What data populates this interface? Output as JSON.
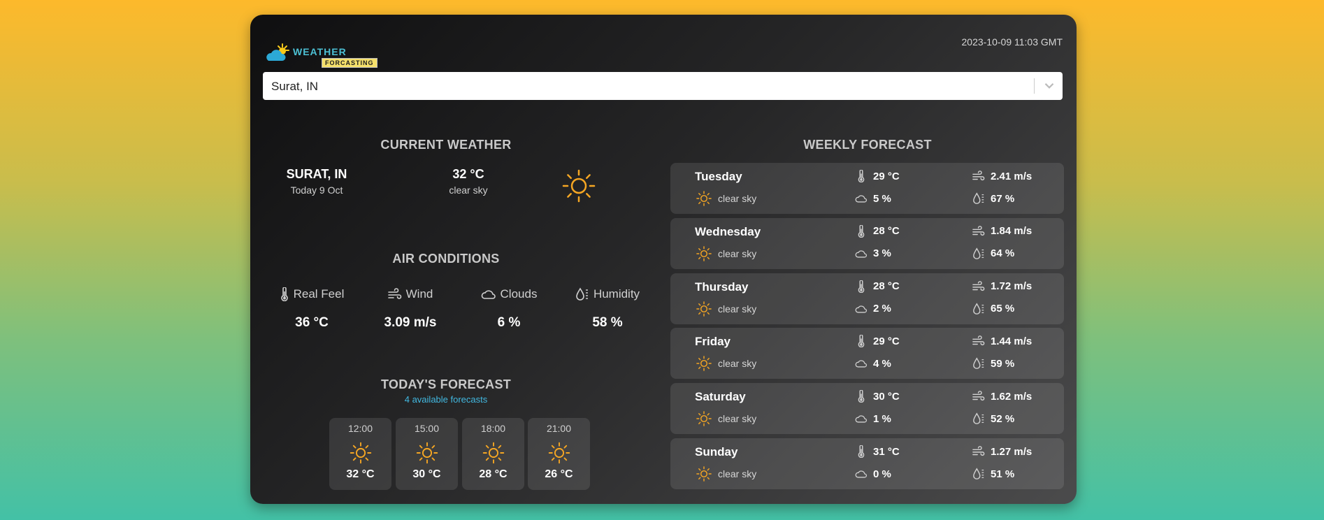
{
  "header": {
    "logo": {
      "word": "WEATHER",
      "sub": "FORCASTING"
    },
    "datetime": "2023-10-09 11:03 GMT"
  },
  "search": {
    "value": "Surat, IN"
  },
  "current": {
    "heading": "CURRENT WEATHER",
    "city": "SURAT, IN",
    "date": "Today 9 Oct",
    "temp": "32 °C",
    "description": "clear sky",
    "icon": "sun-icon"
  },
  "air_conditions": {
    "heading": "AIR CONDITIONS",
    "items": [
      {
        "label": "Real Feel",
        "value": "36 °C",
        "icon": "thermometer-icon"
      },
      {
        "label": "Wind",
        "value": "3.09 m/s",
        "icon": "wind-icon"
      },
      {
        "label": "Clouds",
        "value": "6 %",
        "icon": "cloud-icon"
      },
      {
        "label": "Humidity",
        "value": "58 %",
        "icon": "humidity-icon"
      }
    ]
  },
  "today_forecast": {
    "heading": "TODAY'S FORECAST",
    "subtitle": "4 available forecasts",
    "items": [
      {
        "time": "12:00",
        "temp": "32 °C"
      },
      {
        "time": "15:00",
        "temp": "30 °C"
      },
      {
        "time": "18:00",
        "temp": "28 °C"
      },
      {
        "time": "21:00",
        "temp": "26 °C"
      }
    ]
  },
  "weekly_forecast": {
    "heading": "WEEKLY FORECAST",
    "days": [
      {
        "day": "Tuesday",
        "desc": "clear sky",
        "temp": "29 °C",
        "clouds": "5 %",
        "wind": "2.41 m/s",
        "humidity": "67 %"
      },
      {
        "day": "Wednesday",
        "desc": "clear sky",
        "temp": "28 °C",
        "clouds": "3 %",
        "wind": "1.84 m/s",
        "humidity": "64 %"
      },
      {
        "day": "Thursday",
        "desc": "clear sky",
        "temp": "28 °C",
        "clouds": "2 %",
        "wind": "1.72 m/s",
        "humidity": "65 %"
      },
      {
        "day": "Friday",
        "desc": "clear sky",
        "temp": "29 °C",
        "clouds": "4 %",
        "wind": "1.44 m/s",
        "humidity": "59 %"
      },
      {
        "day": "Saturday",
        "desc": "clear sky",
        "temp": "30 °C",
        "clouds": "1 %",
        "wind": "1.62 m/s",
        "humidity": "52 %"
      },
      {
        "day": "Sunday",
        "desc": "clear sky",
        "temp": "31 °C",
        "clouds": "0 %",
        "wind": "1.27 m/s",
        "humidity": "51 %"
      }
    ]
  },
  "colors": {
    "accent_sun": "#f5a623",
    "subtitle_blue": "#42b8e0"
  }
}
